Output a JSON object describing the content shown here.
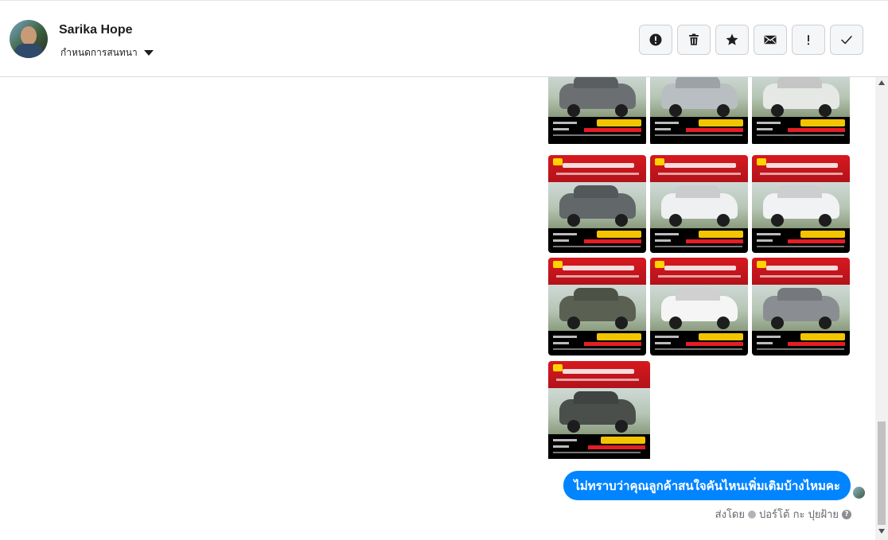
{
  "header": {
    "contact_name": "Sarika Hope",
    "assign_label": "กำหนดการสนทนา",
    "actions": [
      {
        "name": "report-spam",
        "icon": "alert-circle-icon"
      },
      {
        "name": "delete",
        "icon": "trash-icon"
      },
      {
        "name": "star",
        "icon": "star-icon"
      },
      {
        "name": "mark-unread",
        "icon": "envelope-icon"
      },
      {
        "name": "important",
        "icon": "exclamation-icon"
      },
      {
        "name": "done",
        "icon": "check-icon"
      }
    ]
  },
  "thread": {
    "image_tiles": [
      {
        "color": "#6b6f72",
        "variant": "top"
      },
      {
        "color": "#b9bec3",
        "variant": "top"
      },
      {
        "color": "#e6e8e6",
        "variant": "top"
      },
      {
        "color": "#62676a",
        "variant": "full"
      },
      {
        "color": "#eef0f2",
        "variant": "full"
      },
      {
        "color": "#f1f2f3",
        "variant": "full"
      },
      {
        "color": "#5a6052",
        "variant": "full"
      },
      {
        "color": "#f5f5f5",
        "variant": "full"
      },
      {
        "color": "#8a8e92",
        "variant": "full"
      },
      {
        "color": "#4a4f4c",
        "variant": "full"
      }
    ],
    "message": "ไม่ทราบว่าคุณลูกค้าสนใจคันไหนเพิ่มเติมบ้างไหมคะ",
    "sent_by_prefix": "ส่งโดย",
    "sender": "ปอร์โต้ กะ ปุยฝ้าย",
    "help_glyph": "?"
  },
  "colors": {
    "bubble": "#0084ff",
    "banner_red": "#d7191f"
  }
}
